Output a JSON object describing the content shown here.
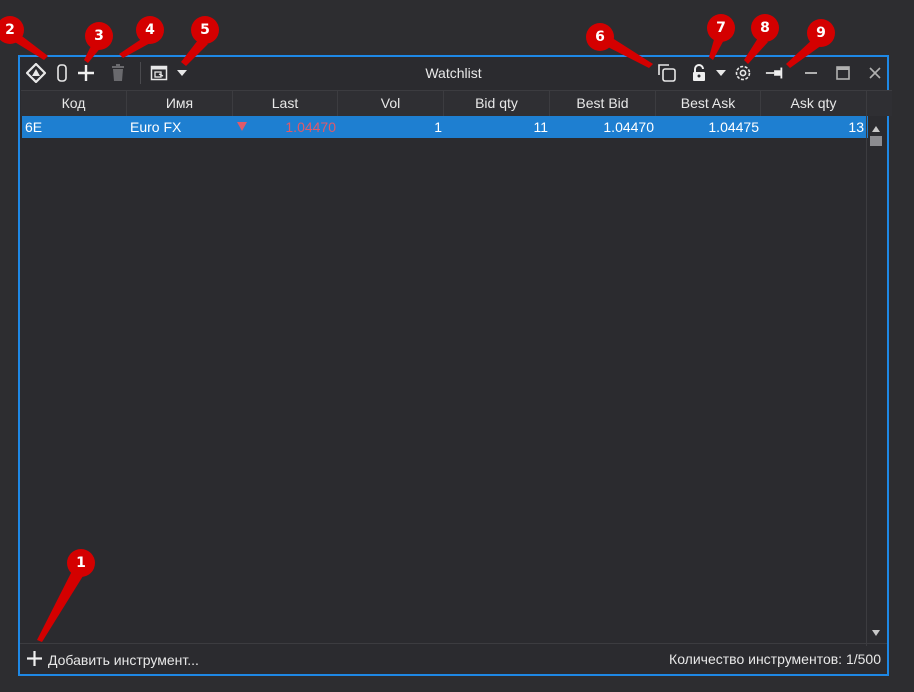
{
  "window": {
    "title": "Watchlist"
  },
  "toolbar": {
    "icons": [
      "logo-icon",
      "instrument-icon",
      "add-icon",
      "delete-icon",
      "template-icon",
      "dropdown-icon",
      "copy-icon",
      "lock-icon",
      "lock-dropdown-icon",
      "settings-icon",
      "pin-icon",
      "minimize-icon",
      "maximize-icon",
      "close-icon"
    ]
  },
  "table": {
    "columns": [
      "Код",
      "Имя",
      "Last",
      "Vol",
      "Bid qty",
      "Best Bid",
      "Best Ask",
      "Ask qty"
    ],
    "rows": [
      {
        "code": "6E",
        "name": "Euro FX",
        "last": "1.04470",
        "vol": "1",
        "bid_qty": "11",
        "best_bid": "1.04470",
        "best_ask": "1.04475",
        "ask_qty": "13"
      }
    ]
  },
  "footer": {
    "add_label": "Добавить инструмент...",
    "count_label": "Количество инструментов: 1/500"
  },
  "callouts": [
    "1",
    "2",
    "3",
    "4",
    "5",
    "6",
    "7",
    "8",
    "9"
  ],
  "colors": {
    "accent": "#1e88e5",
    "selected_row": "#1e7fd1",
    "down": "#e05a6a",
    "callout": "#d40000"
  }
}
